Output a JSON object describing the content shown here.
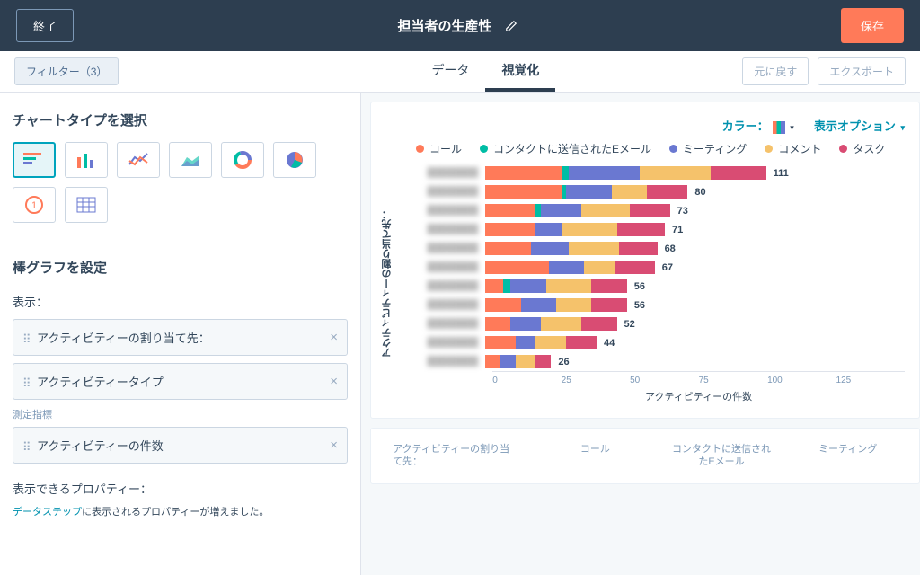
{
  "topbar": {
    "exit": "終了",
    "title": "担当者の生産性",
    "save": "保存"
  },
  "tabbar": {
    "filters": "フィルター（3）",
    "tabs": [
      {
        "label": "データ",
        "active": false
      },
      {
        "label": "視覚化",
        "active": true
      }
    ],
    "undo": "元に戻す",
    "export": "エクスポート"
  },
  "sidebar": {
    "chart_type_heading": "チャートタイプを選択",
    "config_heading": "棒グラフを設定",
    "display_label": "表示：",
    "metric_label": "測定指標",
    "fields": {
      "assignee": "アクティビティーの割り当て先：",
      "activity_type": "アクティビティータイプ",
      "activity_count": "アクティビティーの件数"
    },
    "avail_props_label": "表示できるプロパティー：",
    "step_link": "データステップ",
    "step_text": "に表示されるプロパティーが増えました。"
  },
  "panel_hdr": {
    "color_label": "カラー：",
    "display_opts": "表示オプション"
  },
  "legend": {
    "call": "コール",
    "email": "コンタクトに送信されたEメール",
    "meeting": "ミーティング",
    "comment": "コメント",
    "task": "タスク"
  },
  "chart_data": {
    "type": "bar",
    "orientation": "horizontal",
    "stacked": true,
    "ylabel": "アクティビティーの割り当て先：",
    "xlabel": "アクティビティーの件数",
    "xticks": [
      0,
      25,
      50,
      75,
      100,
      125
    ],
    "xlim": [
      0,
      135
    ],
    "series_names": [
      "コール",
      "コンタクトに送信されたEメール",
      "ミーティング",
      "コメント",
      "タスク"
    ],
    "colors": {
      "call": "#ff7a59",
      "email": "#00bda5",
      "meeting": "#6a78d1",
      "comment": "#f5c26b",
      "task": "#d94c73"
    },
    "rows": [
      {
        "total": 111,
        "call": 30,
        "email": 3,
        "meeting": 28,
        "comment": 28,
        "task": 22
      },
      {
        "total": 80,
        "call": 30,
        "email": 2,
        "meeting": 18,
        "comment": 14,
        "task": 16
      },
      {
        "total": 73,
        "call": 20,
        "email": 2,
        "meeting": 16,
        "comment": 19,
        "task": 16
      },
      {
        "total": 71,
        "call": 20,
        "email": 0,
        "meeting": 10,
        "comment": 22,
        "task": 19
      },
      {
        "total": 68,
        "call": 18,
        "email": 0,
        "meeting": 15,
        "comment": 20,
        "task": 15
      },
      {
        "total": 67,
        "call": 25,
        "email": 0,
        "meeting": 14,
        "comment": 12,
        "task": 16
      },
      {
        "total": 56,
        "call": 7,
        "email": 3,
        "meeting": 14,
        "comment": 18,
        "task": 14
      },
      {
        "total": 56,
        "call": 14,
        "email": 0,
        "meeting": 14,
        "comment": 14,
        "task": 14
      },
      {
        "total": 52,
        "call": 10,
        "email": 0,
        "meeting": 12,
        "comment": 16,
        "task": 14
      },
      {
        "total": 44,
        "call": 12,
        "email": 0,
        "meeting": 8,
        "comment": 12,
        "task": 12
      },
      {
        "total": 26,
        "call": 6,
        "email": 0,
        "meeting": 6,
        "comment": 8,
        "task": 6
      }
    ]
  },
  "table": {
    "col1": "アクティビティーの割り当て先：",
    "cols": [
      "コール",
      "コンタクトに送信されたEメール",
      "ミーティング"
    ]
  }
}
